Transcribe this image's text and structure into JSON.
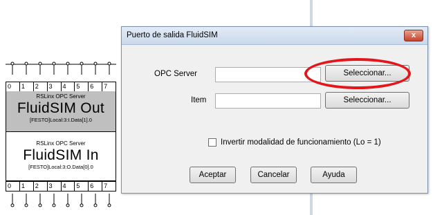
{
  "dialog": {
    "title": "Puerto de salida FluidSIM",
    "close_label": "x",
    "opc_server_label": "OPC Server",
    "opc_server_value": "",
    "item_label": "Item",
    "item_value": "",
    "select_button_1": "Seleccionar...",
    "select_button_2": "Seleccionar...",
    "checkbox_label": "Invertir modalidad de funcionamiento (Lo = 1)",
    "checkbox_checked": false,
    "ok_button": "Aceptar",
    "cancel_button": "Cancelar",
    "help_button": "Ayuda"
  },
  "components": {
    "top_digits": [
      "0",
      "1",
      "2",
      "3",
      "4",
      "5",
      "6",
      "7"
    ],
    "out_block": {
      "server": "RSLinx OPC Server",
      "name": "FluidSIM Out",
      "tag": "[FESTO]Local:3:I.Data[1].0"
    },
    "in_block": {
      "server": "RSLinx OPC Server",
      "name": "FluidSIM In",
      "tag": "[FESTO]Local:3:O.Data[0].0"
    },
    "bottom_digits": [
      "0",
      "1",
      "2",
      "3",
      "4",
      "5",
      "6",
      "7"
    ]
  },
  "colors": {
    "highlight": "#e3161b",
    "out_block_bg": "#bfbfbf",
    "close_button": "#c7402a"
  }
}
